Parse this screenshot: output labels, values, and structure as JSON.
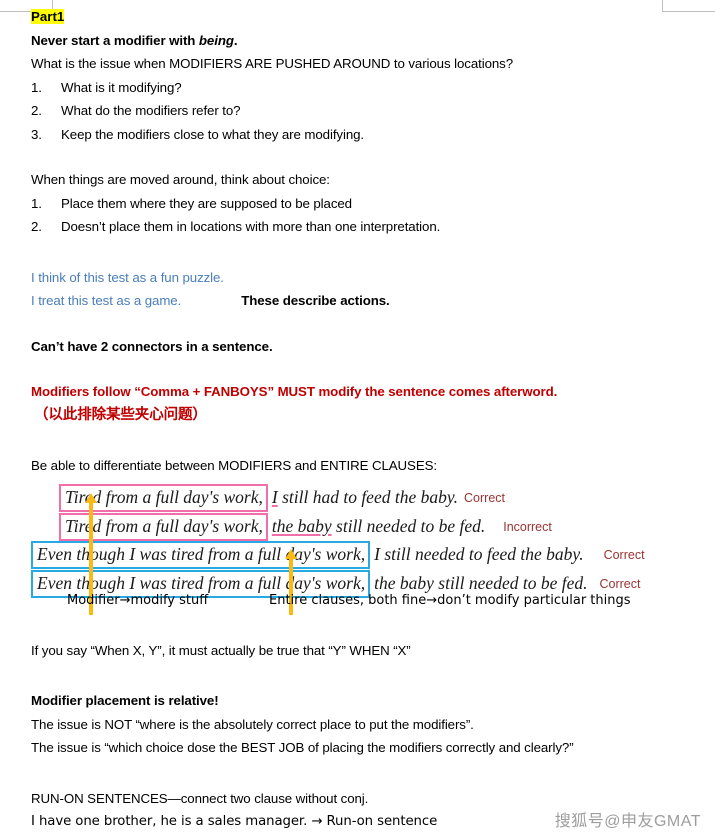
{
  "document": {
    "part_label": "Part1",
    "heading_rule": {
      "before": "Never start a modifier with ",
      "italic": "being",
      "after": "."
    },
    "question_pushed": "What is the issue when MODIFIERS ARE PUSHED AROUND to various locations?",
    "pushed_list": [
      {
        "num": "1.",
        "text": "What is it modifying?"
      },
      {
        "num": "2.",
        "text": "What do the modifiers refer to?"
      },
      {
        "num": "3.",
        "text": "Keep the modifiers close to what they are modifying."
      }
    ],
    "moved_intro": "When things are moved around, think about choice:",
    "moved_list": [
      {
        "num": "1.",
        "text": "Place them where they are supposed to be placed"
      },
      {
        "num": "2.",
        "text": "Doesn’t place them in locations with more than one interpretation."
      }
    ],
    "blue_examples": [
      "I think of this test as a fun puzzle.",
      "I treat this test as a game."
    ],
    "blue_note": "These describe actions.",
    "connectors_rule": "Can’t have 2 connectors in a sentence.",
    "fanboys_rule": "Modifiers follow “Comma + FANBOYS” MUST modify the sentence comes afterword.",
    "fanboys_rule_cn": "（以此排除某些夹心问题）",
    "differentiate_intro": "Be able to differentiate between MODIFIERS and ENTIRE CLAUSES:",
    "examples": [
      {
        "box_color": "#f06eaa",
        "box_text": "Tired from a full day's work,",
        "tail_underlined": "I",
        "tail_rest": " still had to feed the baby.",
        "verdict": "Correct"
      },
      {
        "box_color": "#f06eaa",
        "box_text": "Tired from a full day's work,",
        "tail_underlined": "the baby",
        "tail_rest": " still needed to be fed.",
        "verdict": "Incorrect"
      },
      {
        "box_color": "#27aae1",
        "box_text": "Even though I was tired from a full day's work,",
        "tail_underlined": "",
        "tail_rest": "I still needed to feed the baby.",
        "verdict": "Correct"
      },
      {
        "box_color": "#27aae1",
        "box_text": "Even though I was tired from a full day's work,",
        "tail_underlined": "",
        "tail_rest": "the baby still needed to be fed.",
        "verdict": "Correct"
      }
    ],
    "annotations": [
      {
        "text": "Modifier→modify stuff"
      },
      {
        "text": "Entire clauses, both fine→don’t modify particular things"
      }
    ],
    "when_rule": "If you say “When X, Y”, it must actually be true that “Y” WHEN “X”",
    "placement_heading": "Modifier placement is relative!",
    "placement_not": "The issue is NOT “where is the absolutely correct place to put the modifiers”.",
    "placement_is": "The issue is “which choice dose the BEST JOB of placing the modifiers correctly and clearly?”",
    "runon_heading": "RUN-ON SENTENCES—connect two clause without conj.",
    "runon_example": "I have one brother, he is a sales manager. → Run-on sentence",
    "watermark": "搜狐号@申友GMAT"
  },
  "colors": {
    "highlight": "#ffff00",
    "blue_text": "#4a7ebb",
    "red_text": "#c00000",
    "pink_box": "#f06eaa",
    "blue_box": "#27aae1",
    "arrow": "#fdb913",
    "verdict": "#993333"
  }
}
